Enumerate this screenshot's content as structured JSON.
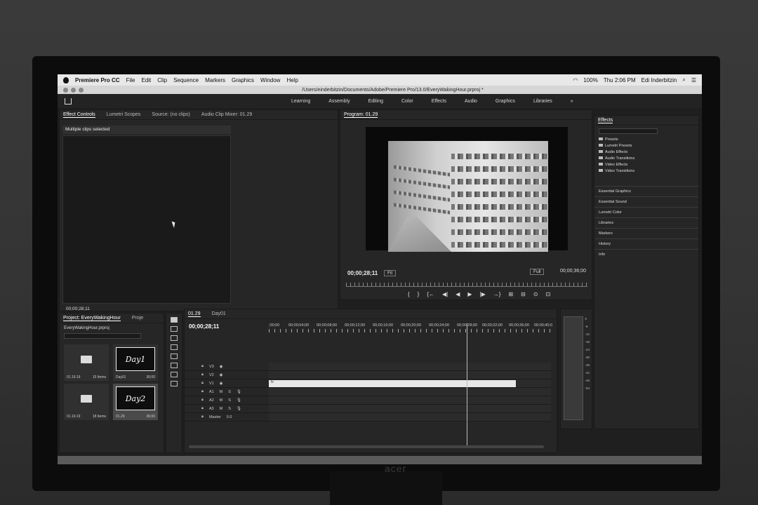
{
  "menubar": {
    "app_name": "Premiere Pro CC",
    "items": [
      "File",
      "Edit",
      "Clip",
      "Sequence",
      "Markers",
      "Graphics",
      "Window",
      "Help"
    ],
    "battery": "100%",
    "clock": "Thu 2:06 PM",
    "user": "Edi Inderbitzin"
  },
  "titlebar": {
    "path": "/Users/einderbitzin/Documents/Adobe/Premiere Pro/13.0/EveryWakingHour.prproj *"
  },
  "workspaces": [
    "Learning",
    "Assembly",
    "Editing",
    "Color",
    "Effects",
    "Audio",
    "Graphics",
    "Libraries",
    "»"
  ],
  "effect_controls": {
    "tabs": [
      "Effect Controls",
      "Lumetri Scopes",
      "Source: (no clips)",
      "Audio Clip Mixer: 01.29"
    ],
    "selection_text": "Multiple clips selected",
    "timecode": "00;00;28;11"
  },
  "program_monitor": {
    "title": "Program: 01.29",
    "timecode": "00;00;28;11",
    "fit": "Fit",
    "quality": "Full",
    "duration": "00;00;36;00",
    "controls": [
      "{",
      "}",
      "{←",
      "◀|",
      "◀",
      "▶",
      "|▶",
      "→}",
      "⊞",
      "⊟",
      "⊙",
      "⊡"
    ]
  },
  "effects_panel": {
    "title": "Effects",
    "folders": [
      "Presets",
      "Lumetri Presets",
      "Audio Effects",
      "Audio Transitions",
      "Video Effects",
      "Video Transitions"
    ],
    "sections": [
      "Essential Graphics",
      "Essential Sound",
      "Lumetri Color",
      "Libraries",
      "Markers",
      "History",
      "Info"
    ]
  },
  "project": {
    "tabs": [
      "Project: EveryWakingHour",
      "Proje"
    ],
    "file": "EveryWakingHour.prproj",
    "bins": [
      {
        "label": "01.19.19",
        "meta": "15 Items",
        "kind": "folder",
        "thumb_text": ""
      },
      {
        "label": "Day01",
        "meta": "30;00",
        "kind": "sequence",
        "thumb_text": "Day1"
      },
      {
        "label": "01.19.19",
        "meta": "18 Items",
        "kind": "folder",
        "thumb_text": ""
      },
      {
        "label": "01.29",
        "meta": "36;00",
        "kind": "sequence",
        "thumb_text": "Day2"
      }
    ]
  },
  "timeline": {
    "tabs": [
      "01.29",
      "Day01"
    ],
    "timecode": "00;00;28;11",
    "ruler": [
      ";00;00",
      "00;00;04;00",
      "00;00;08;00",
      "00;00;12;00",
      "00;00;16;00",
      "00;00;20;00",
      "00;00;24;00",
      "00;00;28;00",
      "00;00;32;00",
      "00;00;36;00",
      "00;00;40;0"
    ],
    "tracks": [
      {
        "name": "V3",
        "type": "video"
      },
      {
        "name": "V2",
        "type": "video"
      },
      {
        "name": "V1",
        "type": "video"
      },
      {
        "name": "A1",
        "type": "audio"
      },
      {
        "name": "A2",
        "type": "audio"
      },
      {
        "name": "A3",
        "type": "audio"
      }
    ],
    "master": {
      "label": "Master",
      "value": "0.0"
    },
    "clip_label": "fx"
  },
  "meters": {
    "scale": [
      "0",
      "-6",
      "-12",
      "-18",
      "-24",
      "-30",
      "-36",
      "-42",
      "-48",
      "-54"
    ]
  },
  "monitor_brand": "acer"
}
